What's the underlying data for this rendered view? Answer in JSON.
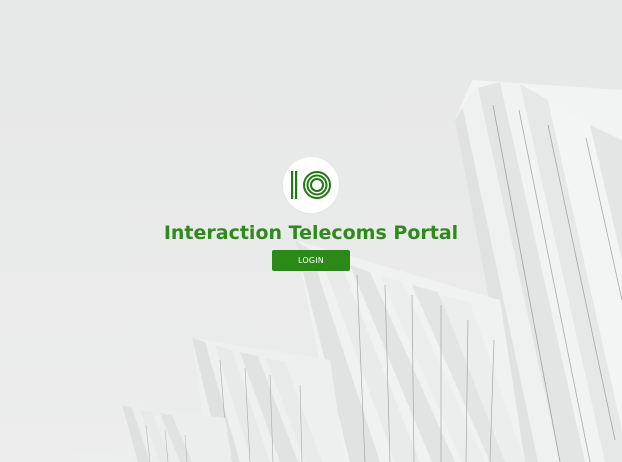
{
  "portal": {
    "title": "Interaction Telecoms Portal",
    "login_label": "LOGIN"
  },
  "colors": {
    "brand_green": "#2e8b1b",
    "button_green": "#2b8a17",
    "background": "#e9eaea"
  },
  "icons": {
    "logo": "interaction-telecoms-logo-icon"
  }
}
